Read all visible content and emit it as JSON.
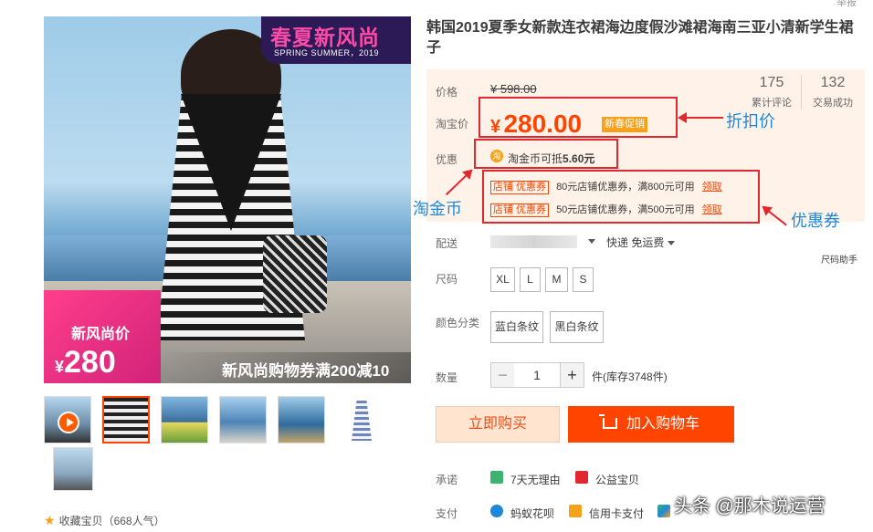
{
  "report_text": "举报",
  "main_image": {
    "promo_top_title": "春夏新风尚",
    "promo_top_sub": "SPRING SUMMER，2019",
    "promo_left_title": "新风尚价",
    "promo_left_currency": "¥",
    "promo_left_price": "280",
    "promo_bottom_text": "新风尚购物券满200减10"
  },
  "favorite": {
    "label": "收藏宝贝（668人气）"
  },
  "product": {
    "title": "韩国2019夏季女新款连衣裙海边度假沙滩裙海南三亚小清新学生裙子",
    "labels": {
      "price": "价格",
      "taobao_price": "淘宝价",
      "discount": "优惠",
      "shipping": "配送",
      "size": "尺码",
      "color": "颜色分类",
      "quantity": "数量",
      "promise": "承诺",
      "payment": "支付"
    },
    "original_price": "¥ 598.00",
    "currency": "¥",
    "current_price": "280.00",
    "promo_badge": "新春促销",
    "stats": [
      {
        "value": "175",
        "label": "累计评论"
      },
      {
        "value": "132",
        "label": "交易成功"
      }
    ],
    "coin_icon_text": "淘",
    "coin_text": "淘金币可抵",
    "coin_amount": "5.60元",
    "coupons": [
      {
        "tag": "店铺 优惠券",
        "desc": "80元店铺优惠券，满800元可用",
        "claim": "领取"
      },
      {
        "tag": "店铺 优惠券",
        "desc": "50元店铺优惠券，满500元可用",
        "claim": "领取"
      }
    ],
    "shipping_method": "快递 免运费",
    "size_helper": "尺码助手",
    "sizes": [
      "XL",
      "L",
      "M",
      "S"
    ],
    "colors": [
      "蓝白条纹",
      "黑白条纹"
    ],
    "quantity_value": "1",
    "minus": "−",
    "plus": "+",
    "stock": "件(库存3748件)",
    "buy_now": "立即购买",
    "add_to_cart": "加入购物车",
    "promises": [
      "7天无理由",
      "公益宝贝"
    ],
    "payments": [
      "蚂蚁花呗",
      "信用卡支付"
    ]
  },
  "annotations": {
    "discount_price": "折扣价",
    "taobao_coin": "淘金币",
    "coupon": "优惠券"
  },
  "watermark": "头条 @那木说运营",
  "colors": {
    "accent": "#ff4400",
    "annotation_box": "#e0282e",
    "annotation_text": "#1e88d8",
    "price_bg": "#fff2e8"
  }
}
